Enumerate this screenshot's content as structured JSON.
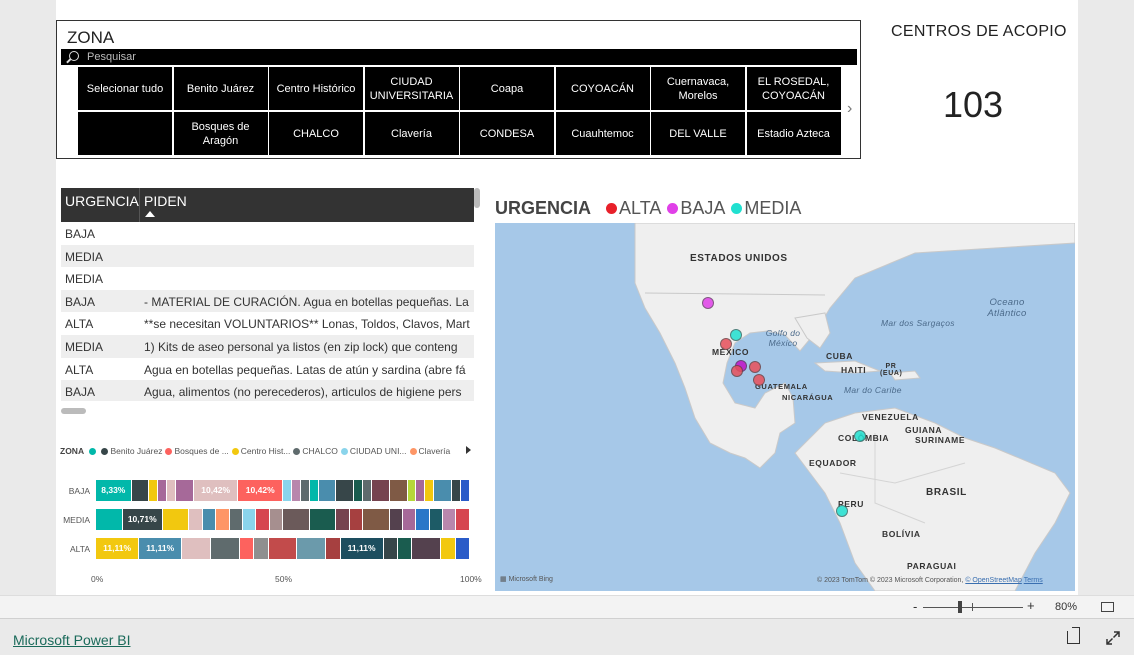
{
  "slicer": {
    "title": "ZONA",
    "search_placeholder": "Pesquisar",
    "items": [
      "Selecionar tudo",
      "Benito Juárez",
      "Centro Histórico",
      "CIUDAD UNIVERSITARIA",
      "Coapa",
      "COYOACÁN",
      "Cuernavaca, Morelos",
      "EL ROSEDAL, COYOACÁN",
      "",
      "Bosques de Aragón",
      "CHALCO",
      "Clavería",
      "CONDESA",
      "Cuauhtemoc",
      "DEL VALLE",
      "Estadio Azteca"
    ],
    "next_icon": "chevron-right-icon"
  },
  "card": {
    "label": "CENTROS DE ACOPIO",
    "value": "103"
  },
  "table": {
    "headers": [
      "URGENCIA",
      "PIDEN"
    ],
    "sort_icon": "sort-ascending-icon",
    "rows": [
      {
        "urgencia": "BAJA",
        "piden": ""
      },
      {
        "urgencia": "MEDIA",
        "piden": ""
      },
      {
        "urgencia": "MEDIA",
        "piden": ""
      },
      {
        "urgencia": "BAJA",
        "piden": "- MATERIAL DE CURACIÓN. Agua en botellas pequeñas. La"
      },
      {
        "urgencia": "ALTA",
        "piden": "**se necesitan VOLUNTARIOS** Lonas, Toldos, Clavos, Mart"
      },
      {
        "urgencia": "MEDIA",
        "piden": "1) Kits de aseo personal ya listos (en zip lock) que conteng"
      },
      {
        "urgencia": "ALTA",
        "piden": "Agua en botellas pequeñas. Latas de atún y sardina (abre fá"
      },
      {
        "urgencia": "BAJA",
        "piden": "Agua, alimentos (no perecederos), articulos de higiene pers"
      }
    ]
  },
  "chart_data": {
    "type": "bar",
    "stacked": "100%",
    "orientation": "horizontal",
    "legend_title": "ZONA",
    "legend": [
      {
        "name": "",
        "color": "#01b8aa"
      },
      {
        "name": "Benito Juárez",
        "color": "#374649"
      },
      {
        "name": "Bosques de ...",
        "color": "#fd625e"
      },
      {
        "name": "Centro Hist...",
        "color": "#f2c80f"
      },
      {
        "name": "CHALCO",
        "color": "#5f6b6d"
      },
      {
        "name": "CIUDAD UNI...",
        "color": "#8ad4eb"
      },
      {
        "name": "Clavería",
        "color": "#fe9666"
      }
    ],
    "categories": [
      "BAJA",
      "MEDIA",
      "ALTA"
    ],
    "x_ticks": [
      "0%",
      "50%",
      "100%"
    ],
    "xlim": [
      0,
      100
    ],
    "bars": [
      {
        "category": "BAJA",
        "segments": [
          {
            "value": 8.33,
            "label": "8,33%",
            "color": "#01b8aa"
          },
          {
            "value": 4.17,
            "color": "#374649"
          },
          {
            "value": 2.08,
            "color": "#f2c80f"
          },
          {
            "value": 2.08,
            "color": "#a66999"
          },
          {
            "value": 2.08,
            "color": "#dfbfbf"
          },
          {
            "value": 4.17,
            "color": "#a66999"
          },
          {
            "value": 10.42,
            "label": "10,42%",
            "color": "#dfbfbf"
          },
          {
            "value": 10.42,
            "label": "10,42%",
            "color": "#fd625e"
          },
          {
            "value": 2.08,
            "color": "#8ad4eb"
          },
          {
            "value": 2.08,
            "color": "#b887ad"
          },
          {
            "value": 2.08,
            "color": "#5f6b6d"
          },
          {
            "value": 2.08,
            "color": "#01b8aa"
          },
          {
            "value": 4.17,
            "color": "#4a8dad"
          },
          {
            "value": 4.17,
            "color": "#374649"
          },
          {
            "value": 2.08,
            "color": "#1a5c4f"
          },
          {
            "value": 2.08,
            "color": "#5f6b6d"
          },
          {
            "value": 4.17,
            "color": "#76434f"
          },
          {
            "value": 4.17,
            "color": "#7f5a45"
          },
          {
            "value": 2.08,
            "color": "#b6d83a"
          },
          {
            "value": 2.08,
            "color": "#a66999"
          },
          {
            "value": 2.08,
            "color": "#f2c80f"
          },
          {
            "value": 4.17,
            "color": "#4a8dad"
          },
          {
            "value": 2.08,
            "color": "#374649"
          },
          {
            "value": 2.08,
            "color": "#2a5bc8"
          }
        ]
      },
      {
        "category": "MEDIA",
        "segments": [
          {
            "value": 7.14,
            "color": "#01b8aa"
          },
          {
            "value": 10.71,
            "label": "10,71%",
            "color": "#374649"
          },
          {
            "value": 7.14,
            "color": "#f2c80f"
          },
          {
            "value": 3.57,
            "color": "#dfbfbf"
          },
          {
            "value": 3.57,
            "color": "#4a8dad"
          },
          {
            "value": 3.57,
            "color": "#fe9666"
          },
          {
            "value": 3.57,
            "color": "#5f6b6d"
          },
          {
            "value": 3.57,
            "color": "#8ad4eb"
          },
          {
            "value": 3.57,
            "color": "#d64550"
          },
          {
            "value": 3.57,
            "color": "#a68f8f"
          },
          {
            "value": 7.14,
            "color": "#6b5a5a"
          },
          {
            "value": 7.14,
            "color": "#1a5c4f"
          },
          {
            "value": 3.57,
            "color": "#76434f"
          },
          {
            "value": 3.57,
            "color": "#a64040"
          },
          {
            "value": 7.14,
            "color": "#7f5a45"
          },
          {
            "value": 3.57,
            "color": "#54414e"
          },
          {
            "value": 3.57,
            "color": "#a66999"
          },
          {
            "value": 3.57,
            "color": "#2a77c8"
          },
          {
            "value": 3.57,
            "color": "#1d5b66"
          },
          {
            "value": 3.57,
            "color": "#b887ad"
          },
          {
            "value": 3.57,
            "color": "#d64550"
          }
        ]
      },
      {
        "category": "ALTA",
        "segments": [
          {
            "value": 11.11,
            "label": "11,11%",
            "color": "#f2c80f"
          },
          {
            "value": 11.11,
            "label": "11,11%",
            "color": "#4a8dad"
          },
          {
            "value": 7.41,
            "color": "#dfbfbf"
          },
          {
            "value": 7.41,
            "color": "#5f6b6d"
          },
          {
            "value": 3.7,
            "color": "#fd625e"
          },
          {
            "value": 3.7,
            "color": "#8f8f8f"
          },
          {
            "value": 7.41,
            "color": "#c24b4b"
          },
          {
            "value": 7.41,
            "color": "#6b9aab"
          },
          {
            "value": 3.7,
            "color": "#a64040"
          },
          {
            "value": 11.11,
            "label": "11,11%",
            "color": "#1d4e5f"
          },
          {
            "value": 3.7,
            "color": "#374649"
          },
          {
            "value": 3.7,
            "color": "#1a5c4f"
          },
          {
            "value": 7.41,
            "color": "#54414e"
          },
          {
            "value": 3.7,
            "color": "#f2c80f"
          },
          {
            "value": 3.7,
            "color": "#2a5bc8"
          }
        ]
      }
    ]
  },
  "map": {
    "legend_title": "URGENCIA",
    "legend": [
      {
        "name": "ALTA",
        "color": "#e8202a"
      },
      {
        "name": "BAJA",
        "color": "#e040e8"
      },
      {
        "name": "MEDIA",
        "color": "#20e0d0"
      }
    ],
    "labels": {
      "usa": "ESTADOS UNIDOS",
      "ocean": "Oceano Atlântico",
      "sargasso": "Mar dos Sargaços",
      "gulf": "Golfo do México",
      "mexico": "MÉXICO",
      "cuba": "CUBA",
      "haiti": "HAITI",
      "pr": "PR (EUA)",
      "caribe": "Mar do Caribe",
      "guatemala": "GUATEMALA",
      "nicaragua": "NICARÁGUA",
      "venezuela": "VENEZUELA",
      "guiana": "GUIANA",
      "suriname": "SURINAME",
      "colombia": "COLÔMBIA",
      "equador": "EQUADOR",
      "brasil": "BRASIL",
      "peru": "PERU",
      "bolivia": "BOLÍVIA",
      "paraguai": "PARAGUAI"
    },
    "attribution": "Microsoft Bing",
    "copyright": "© 2023 TomTom © 2023 Microsoft Corporation,",
    "osm": "© OpenStreetMap",
    "terms": "Terms",
    "markers": [
      {
        "urgencia": "BAJA",
        "color": "#e040e8"
      },
      {
        "urgencia": "MEDIA",
        "color": "#20e0d0"
      },
      {
        "urgencia": "ALTA",
        "color": "#e8505a"
      },
      {
        "urgencia": "BAJA",
        "color": "#c010c8"
      },
      {
        "urgencia": "ALTA",
        "color": "#e8505a"
      },
      {
        "urgencia": "ALTA",
        "color": "#e8505a"
      },
      {
        "urgencia": "ALTA",
        "color": "#e8505a"
      },
      {
        "urgencia": "MEDIA",
        "color": "#20e0d0"
      },
      {
        "urgencia": "MEDIA",
        "color": "#20e0d0"
      }
    ]
  },
  "zoom": {
    "minus": "-",
    "plus": "+",
    "value": "80%"
  },
  "footer": {
    "link": "Microsoft Power BI",
    "share_icon": "share-icon",
    "expand_icon": "expand-icon"
  }
}
